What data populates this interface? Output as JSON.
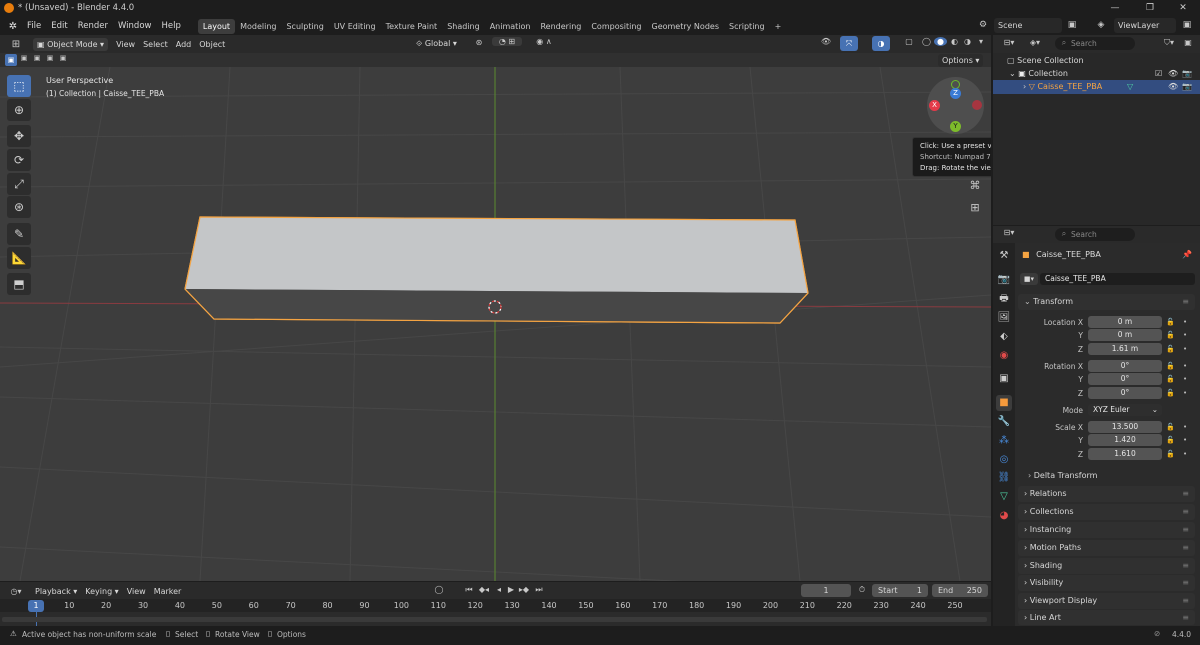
{
  "title": "* (Unsaved) - Blender 4.4.0",
  "window_controls": [
    "—",
    "❐",
    "✕"
  ],
  "menu": [
    "File",
    "Edit",
    "Render",
    "Window",
    "Help"
  ],
  "workspaces": [
    "Layout",
    "Modeling",
    "Sculpting",
    "UV Editing",
    "Texture Paint",
    "Shading",
    "Animation",
    "Rendering",
    "Compositing",
    "Geometry Nodes",
    "Scripting"
  ],
  "add_workspace": "+",
  "scene": {
    "label": "Scene",
    "view_layer": "ViewLayer"
  },
  "viewport_header": {
    "mode": "Object Mode",
    "menus": [
      "View",
      "Select",
      "Add",
      "Object"
    ],
    "orientation": "Global",
    "options": "Options"
  },
  "viewport": {
    "perspective": "User Perspective",
    "collection_info": "(1) Collection | Caisse_TEE_PBA",
    "tooltip": [
      "Click: Use a preset viewpoint",
      "Shortcut: Numpad 7",
      "Drag: Rotate the view"
    ],
    "gizmo": {
      "x": "X",
      "y": "Y",
      "z": "Z"
    },
    "accent": "#4772b3",
    "selection_color": "#f5a442"
  },
  "outliner": {
    "search_placeholder": "Search",
    "rows": [
      "Scene Collection",
      "Collection",
      "Caisse_TEE_PBA"
    ]
  },
  "properties": {
    "search_placeholder": "Search",
    "object_name": "Caisse_TEE_PBA",
    "data_name": "Caisse_TEE_PBA",
    "transform_label": "Transform",
    "location": {
      "label": "Location X",
      "x": "0 m",
      "y": "0 m",
      "z": "1.61 m"
    },
    "rotation": {
      "label": "Rotation X",
      "x": "0°",
      "y": "0°",
      "z": "0°"
    },
    "mode": {
      "label": "Mode",
      "value": "XYZ Euler"
    },
    "scale": {
      "label": "Scale X",
      "x": "13.500",
      "y": "1.420",
      "z": "1.610"
    },
    "axis_y": "Y",
    "axis_z": "Z",
    "delta_transform": "Delta Transform",
    "sections": [
      "Relations",
      "Collections",
      "Instancing",
      "Motion Paths",
      "Shading",
      "Visibility",
      "Viewport Display",
      "Line Art"
    ]
  },
  "timeline": {
    "menus": [
      "Playback",
      "Keying",
      "View",
      "Marker"
    ],
    "current_frame": "1",
    "start_label": "Start",
    "start": "1",
    "end_label": "End",
    "end": "250",
    "ticks": [
      "1",
      "10",
      "20",
      "30",
      "40",
      "50",
      "60",
      "70",
      "80",
      "90",
      "100",
      "110",
      "120",
      "130",
      "140",
      "150",
      "160",
      "170",
      "180",
      "190",
      "200",
      "210",
      "220",
      "230",
      "240",
      "250"
    ]
  },
  "statusbar": {
    "warning": "Active object has non-uniform scale",
    "select": "Select",
    "rotate": "Rotate View",
    "options": "Options",
    "version": "4.4.0"
  }
}
